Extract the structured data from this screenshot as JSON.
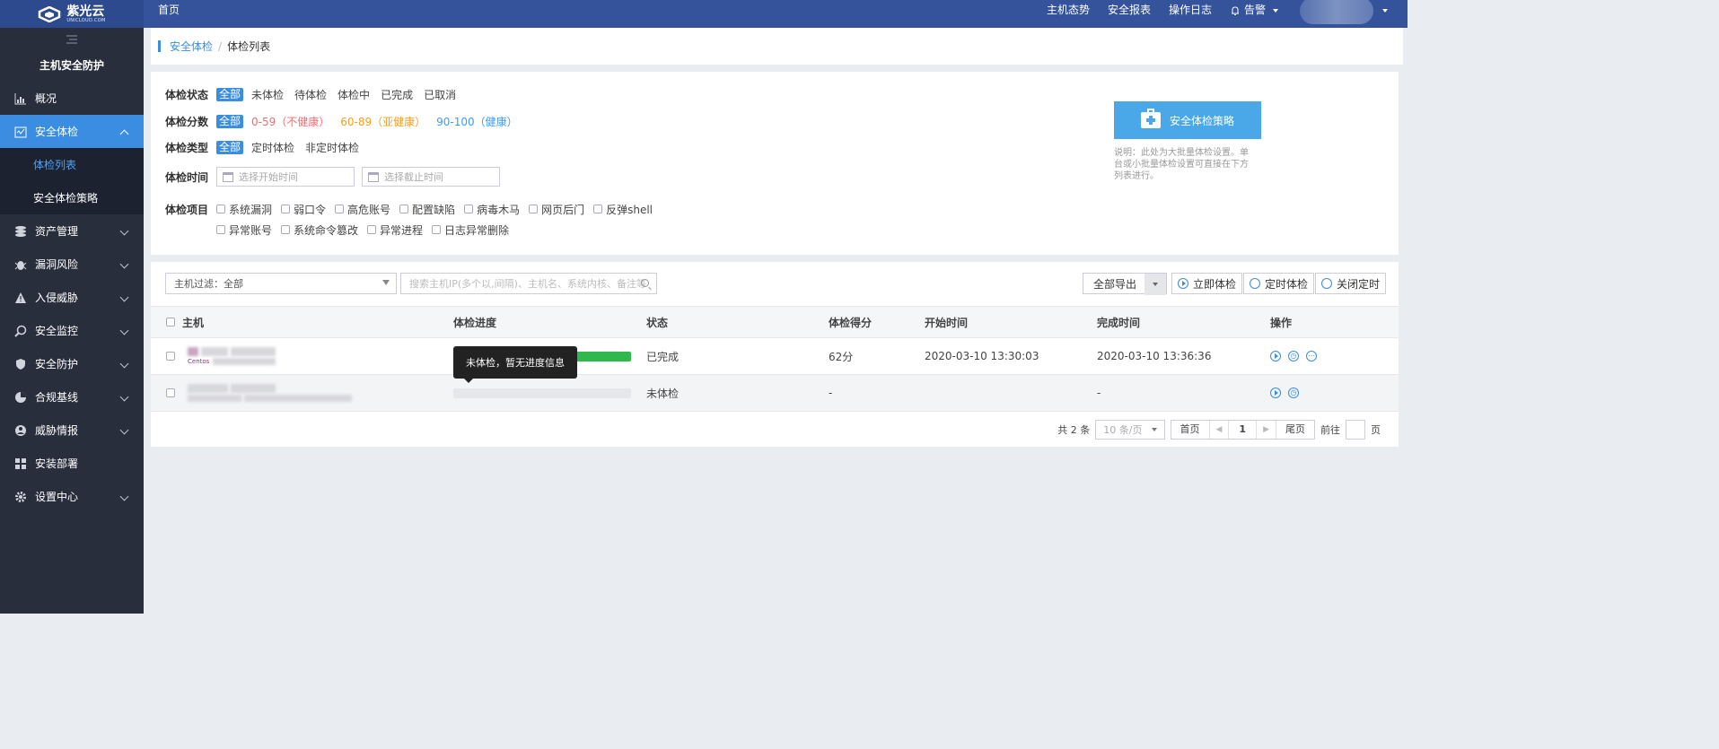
{
  "header": {
    "logo_cn": "紫光云",
    "logo_en": "UNICLOUD.COM",
    "home": "首页",
    "links": [
      "主机态势",
      "安全报表",
      "操作日志"
    ],
    "alert_label": "告警"
  },
  "sidebar": {
    "title": "主机安全防护",
    "items": [
      {
        "label": "概况",
        "icon": "chart-icon"
      },
      {
        "label": "安全体检",
        "icon": "checkup-icon",
        "active": true
      },
      {
        "label": "资产管理",
        "icon": "database-icon"
      },
      {
        "label": "漏洞风险",
        "icon": "bug-icon"
      },
      {
        "label": "入侵威胁",
        "icon": "warning-icon"
      },
      {
        "label": "安全监控",
        "icon": "monitor-icon"
      },
      {
        "label": "安全防护",
        "icon": "shield-icon"
      },
      {
        "label": "合规基线",
        "icon": "pie-icon"
      },
      {
        "label": "威胁情报",
        "icon": "intel-icon"
      },
      {
        "label": "安装部署",
        "icon": "grid-icon"
      },
      {
        "label": "设置中心",
        "icon": "gear-icon"
      }
    ],
    "sub_items": [
      "体检列表",
      "安全体检策略"
    ]
  },
  "breadcrumb": {
    "parent": "安全体检",
    "sep": "/",
    "current": "体检列表"
  },
  "filter": {
    "status": {
      "label": "体检状态",
      "all": "全部",
      "options": [
        "未体检",
        "待体检",
        "体检中",
        "已完成",
        "已取消"
      ]
    },
    "score": {
      "label": "体检分数",
      "all": "全部",
      "opt_red": "0-59（不健康）",
      "opt_orange": "60-89（亚健康）",
      "opt_blue": "90-100（健康）"
    },
    "type": {
      "label": "体检类型",
      "all": "全部",
      "options": [
        "定时体检",
        "非定时体检"
      ]
    },
    "time": {
      "label": "体检时间",
      "start_placeholder": "选择开始时间",
      "end_placeholder": "选择截止时间"
    },
    "items": {
      "label": "体检项目",
      "row1": [
        "系统漏洞",
        "弱口令",
        "高危账号",
        "配置缺陷",
        "病毒木马",
        "网页后门",
        "反弹shell"
      ],
      "row2": [
        "异常账号",
        "系统命令篡改",
        "异常进程",
        "日志异常删除"
      ]
    },
    "policy_button": "安全体检策略",
    "note": "说明：此处为大批量体检设置。单台或小批量体检设置可直接在下方列表进行。"
  },
  "toolbar": {
    "host_filter": "主机过滤：全部",
    "search_placeholder": "搜索主机IP(多个以,间隔)、主机名、系统内核、备注等",
    "export": "全部导出",
    "run_now": "立即体检",
    "schedule": "定时体检",
    "close_schedule": "关闭定时"
  },
  "table": {
    "headers": [
      "主机",
      "体检进度",
      "状态",
      "体检得分",
      "开始时间",
      "完成时间",
      "操作"
    ],
    "rows": [
      {
        "host_tag": "Centos",
        "progress": 1.0,
        "status": "已完成",
        "score": "62分",
        "start": "2020-03-10 13:30:03",
        "end": "2020-03-10 13:36:36"
      },
      {
        "host_tag": "",
        "progress": 0,
        "status": "未体检",
        "score": "-",
        "start": "",
        "end": "-"
      }
    ]
  },
  "tooltip": "未体检，暂无进度信息",
  "pager": {
    "total": "共 2 条",
    "page_size": "10 条/页",
    "first": "首页",
    "current": "1",
    "last": "尾页",
    "goto": "前往",
    "page_unit": "页"
  },
  "colors": {
    "primary": "#3a8de0",
    "header": "#34539a",
    "sidebar": "#282e3b",
    "progress": "#30b84f"
  }
}
